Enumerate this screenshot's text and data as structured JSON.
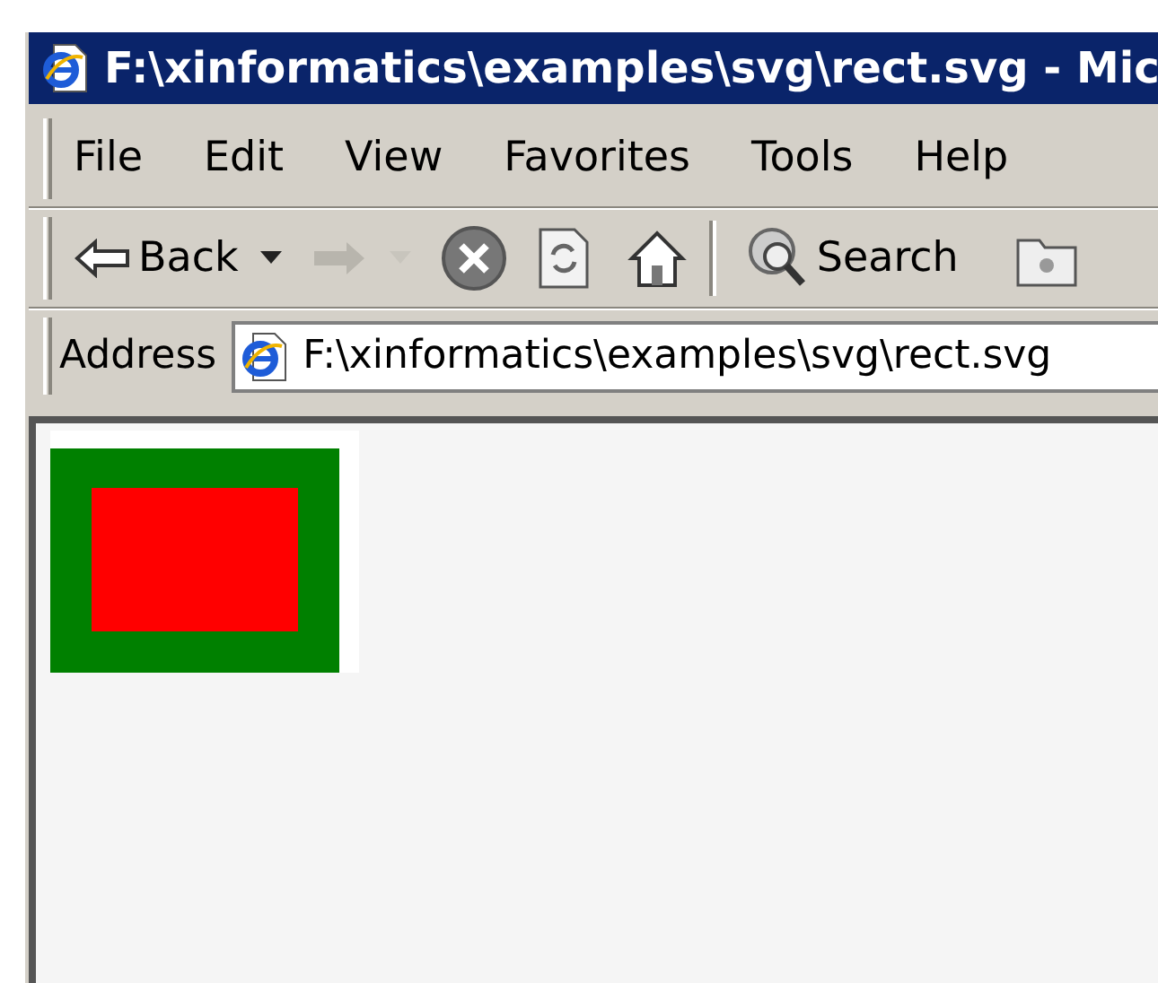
{
  "window": {
    "title": "F:\\xinformatics\\examples\\svg\\rect.svg - Mic"
  },
  "menu": [
    "File",
    "Edit",
    "View",
    "Favorites",
    "Tools",
    "Help"
  ],
  "toolbar": [
    {
      "kind": "back",
      "label": "Back",
      "disabled": false
    },
    {
      "kind": "forward",
      "disabled": true
    },
    {
      "kind": "stop",
      "disabled": false
    },
    {
      "kind": "refresh",
      "disabled": false
    },
    {
      "kind": "home",
      "disabled": false
    },
    {
      "kind": "separator"
    },
    {
      "kind": "search",
      "label": "Search",
      "disabled": false
    },
    {
      "kind": "folder",
      "disabled": false
    }
  ],
  "address": {
    "label": "Address",
    "value": "F:\\xinformatics\\examples\\svg\\rect.svg"
  },
  "content": {
    "kind": "svg-drawing"
  }
}
